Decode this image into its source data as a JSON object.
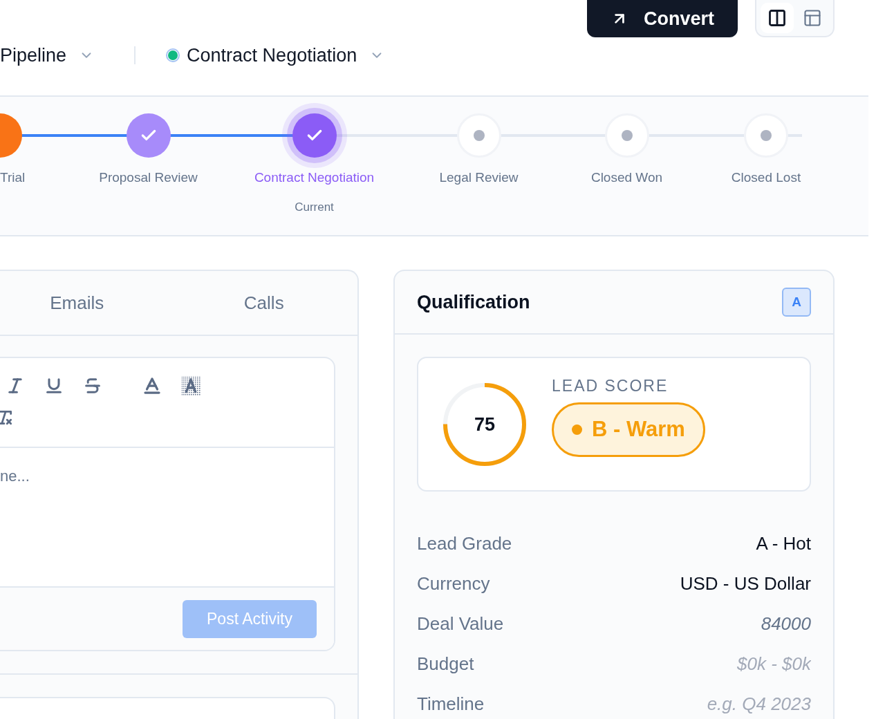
{
  "header": {
    "convert_button": {
      "label": "Convert"
    },
    "view_toggle": [
      {
        "kind": "split",
        "selected": true
      },
      {
        "kind": "panel",
        "selected": false
      }
    ],
    "pipeline_dropdown": {
      "label": "Pipeline"
    },
    "stage_dropdown": {
      "label": "Contract Negotiation",
      "color": "#10b981"
    }
  },
  "stages": [
    {
      "label": "Trial",
      "kind": "done",
      "color": "#f97316"
    },
    {
      "label": "Proposal Review",
      "kind": "done",
      "color": "#a78bfa"
    },
    {
      "label": "Contract Negotiation",
      "kind": "current",
      "color": "#8b5cf6",
      "note": "Current"
    },
    {
      "label": "Legal Review",
      "kind": "upcoming",
      "color": "#aeb4c2"
    },
    {
      "label": "Closed Won",
      "kind": "upcoming",
      "color": "#aeb4c2"
    },
    {
      "label": "Closed Lost",
      "kind": "upcoming",
      "color": "#aeb4c2"
    }
  ],
  "activity_panel": {
    "tabs": [
      {
        "label": "Emails",
        "selected": false
      },
      {
        "label": "Calls",
        "selected": false
      }
    ],
    "editor": {
      "placeholder": "ne..."
    },
    "post_button": {
      "label": "Post Activity",
      "disabled": true
    }
  },
  "qualification": {
    "title": "Qualification",
    "badge": "A",
    "lead_score": {
      "score": "75",
      "level": 0.75,
      "label": "LEAD SCORE",
      "grade": "B - Warm"
    },
    "fields": [
      {
        "label": "Lead Grade",
        "value": "A - Hot",
        "kind": "text"
      },
      {
        "label": "Currency",
        "value": "USD - US Dollar",
        "kind": "text"
      },
      {
        "label": "Deal Value",
        "value": "84000",
        "kind": "input"
      },
      {
        "label": "Budget",
        "placeholder": "$0k - $0k",
        "kind": "placeholder"
      },
      {
        "label": "Timeline",
        "placeholder": "e.g. Q4 2023",
        "kind": "placeholder"
      }
    ]
  }
}
